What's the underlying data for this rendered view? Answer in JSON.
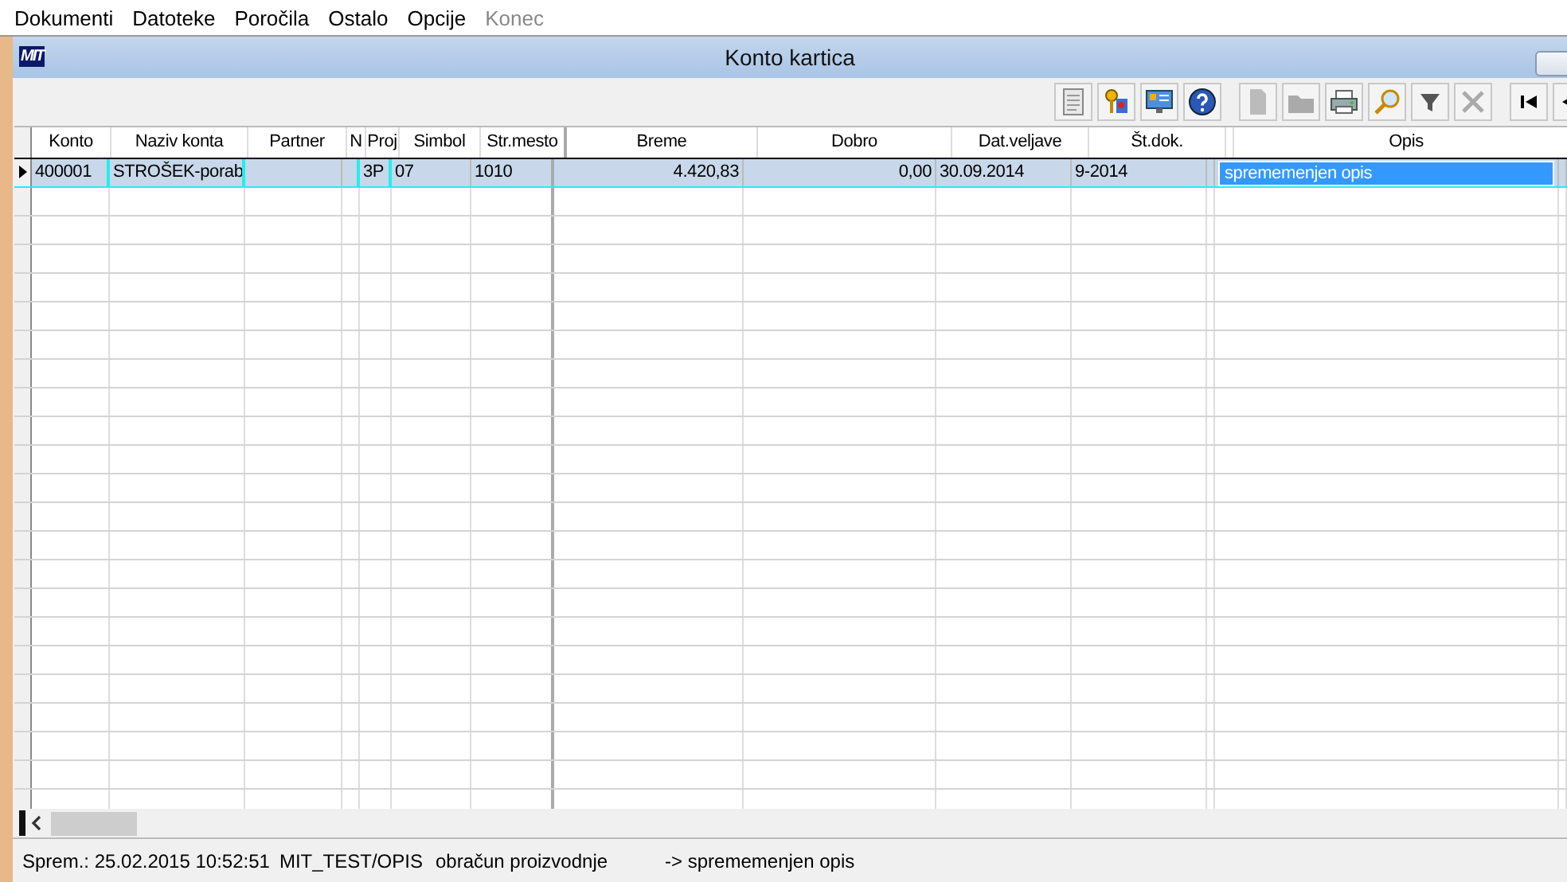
{
  "menu": [
    {
      "label": "Dokumenti",
      "disabled": false
    },
    {
      "label": "Datoteke",
      "disabled": false
    },
    {
      "label": "Poročila",
      "disabled": false
    },
    {
      "label": "Ostalo",
      "disabled": false
    },
    {
      "label": "Opcije",
      "disabled": false
    },
    {
      "label": "Konec",
      "disabled": true
    }
  ],
  "window": {
    "title": "Konto kartica",
    "logo": "MIT"
  },
  "grid": {
    "columns": [
      {
        "label": "Konto"
      },
      {
        "label": "Naziv konta"
      },
      {
        "label": "Partner"
      },
      {
        "label": "N"
      },
      {
        "label": "Proj"
      },
      {
        "label": "Simbol"
      },
      {
        "label": "Str.mesto"
      },
      {
        "label": "Breme"
      },
      {
        "label": "Dobro"
      },
      {
        "label": "Dat.veljave"
      },
      {
        "label": "Št.dok."
      },
      {},
      {
        "label": "Opis"
      }
    ],
    "rows": [
      {
        "selected": true,
        "cells": [
          {
            "text": "400001"
          },
          {
            "text": "STROŠEK-porab"
          },
          {},
          {},
          {
            "text": "3P"
          },
          {
            "text": "07"
          },
          {
            "text": "1010"
          },
          {
            "text": "4.420,83"
          },
          {
            "text": "0,00"
          },
          {
            "text": "30.09.2014"
          },
          {
            "text": "9-2014"
          },
          {}
        ],
        "editor": {
          "value": "sprememenjen opis"
        }
      }
    ]
  },
  "status_bar": [
    "Sprem.: 25.02.2015 10:52:51",
    "MIT_TEST/OPIS",
    "obračun proizvodnje",
    "-> sprememenjen opis"
  ]
}
